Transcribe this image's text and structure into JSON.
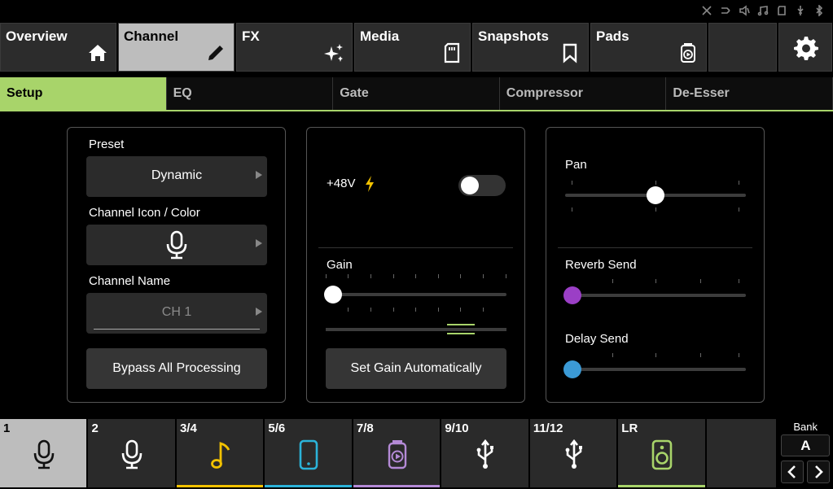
{
  "top_tabs": [
    {
      "label": "Overview",
      "icon": "home-icon"
    },
    {
      "label": "Channel",
      "icon": "pencil-icon",
      "active": true
    },
    {
      "label": "FX",
      "icon": "sparkle-icon"
    },
    {
      "label": "Media",
      "icon": "sd-card-icon"
    },
    {
      "label": "Snapshots",
      "icon": "bookmark-icon"
    },
    {
      "label": "Pads",
      "icon": "pad-icon"
    }
  ],
  "settings_icon": "gear-icon",
  "sub_tabs": [
    {
      "label": "Setup",
      "active": true
    },
    {
      "label": "EQ"
    },
    {
      "label": "Gate"
    },
    {
      "label": "Compressor"
    },
    {
      "label": "De-Esser"
    }
  ],
  "setup": {
    "preset_label": "Preset",
    "preset_value": "Dynamic",
    "icon_color_label": "Channel Icon / Color",
    "channel_name_label": "Channel Name",
    "channel_name_placeholder": "CH 1",
    "bypass_label": "Bypass All Processing"
  },
  "input": {
    "phantom_label": "+48V",
    "phantom_on": false,
    "gain_label": "Gain",
    "gain_level": 0.0,
    "auto_gain_label": "Set Gain Automatically"
  },
  "sends": {
    "pan_label": "Pan",
    "pan_level": 0.5,
    "reverb_label": "Reverb Send",
    "reverb_level": 0.0,
    "delay_label": "Delay Send",
    "delay_level": 0.0
  },
  "colors": {
    "accent": "#a8d46a",
    "reverb": "#9b3fc6",
    "delay": "#3b9ad6",
    "lightning": "#f2c200"
  },
  "channels": [
    {
      "num": "1",
      "icon": "microphone-icon",
      "color": "#bdbdbd",
      "active": true
    },
    {
      "num": "2",
      "icon": "microphone-icon",
      "color": "#ffffff"
    },
    {
      "num": "3/4",
      "icon": "music-note-icon",
      "color": "#f2c200"
    },
    {
      "num": "5/6",
      "icon": "phone-icon",
      "color": "#2bb3d9"
    },
    {
      "num": "7/8",
      "icon": "play-pad-icon",
      "color": "#b48ad6"
    },
    {
      "num": "9/10",
      "icon": "usb-icon",
      "color": "#ffffff"
    },
    {
      "num": "11/12",
      "icon": "usb-icon",
      "color": "#ffffff"
    },
    {
      "num": "LR",
      "icon": "speaker-icon",
      "color": "#a8d46a"
    }
  ],
  "bank": {
    "title": "Bank",
    "value": "A"
  }
}
